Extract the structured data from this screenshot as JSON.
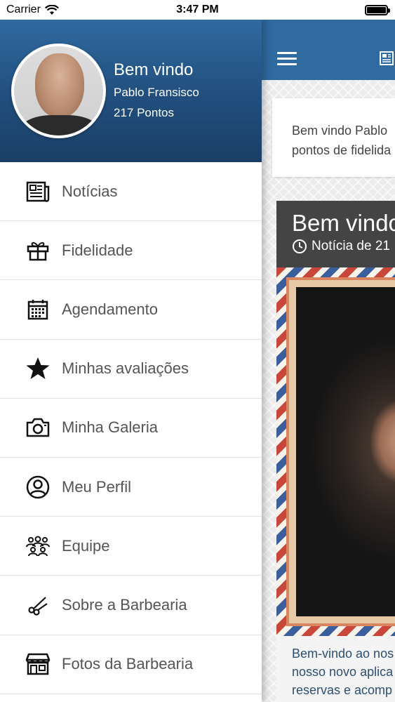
{
  "status_bar": {
    "carrier": "Carrier",
    "time": "3:47 PM"
  },
  "drawer": {
    "welcome": "Bem vindo",
    "user_name": "Pablo Fransisco",
    "points": "217 Pontos",
    "items": [
      {
        "label": "Notícias",
        "icon": "newspaper-icon"
      },
      {
        "label": "Fidelidade",
        "icon": "gift-icon"
      },
      {
        "label": "Agendamento",
        "icon": "calendar-icon"
      },
      {
        "label": "Minhas avaliações",
        "icon": "star-icon"
      },
      {
        "label": "Minha Galeria",
        "icon": "camera-icon"
      },
      {
        "label": "Meu Perfil",
        "icon": "user-circle-icon"
      },
      {
        "label": "Equipe",
        "icon": "team-icon"
      },
      {
        "label": "Sobre a Barbearia",
        "icon": "scissors-icon"
      },
      {
        "label": "Fotos da Barbearia",
        "icon": "storefront-icon"
      }
    ]
  },
  "main": {
    "welcome_card_line1": "Bem vindo Pablo",
    "welcome_card_line2": "pontos de fidelida",
    "news": {
      "title": "Bem vindo",
      "date": "Notícia de 21",
      "excerpt_line1": "Bem-vindo ao nos",
      "excerpt_line2": "nosso novo aplica",
      "excerpt_line3": "reservas e acomp"
    }
  },
  "colors": {
    "brand_blue": "#2f6aa0",
    "header_dark": "#1a3f66",
    "news_header": "#444444",
    "excerpt_text": "#2e4f73"
  }
}
